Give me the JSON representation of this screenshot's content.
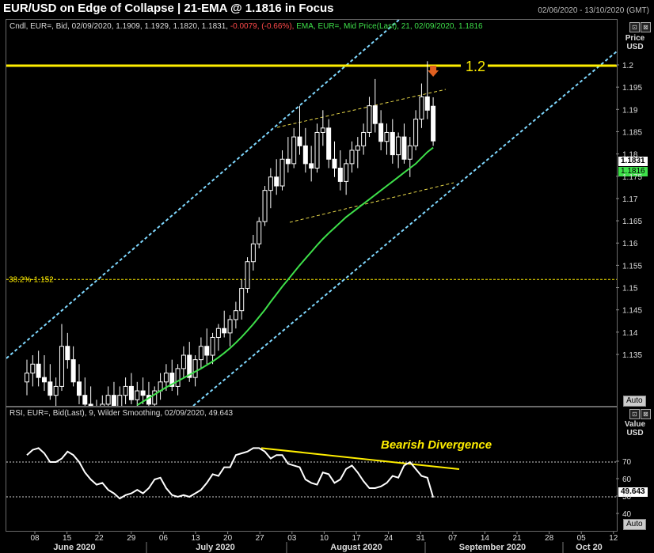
{
  "header": {
    "title": "EUR/USD on Edge of Collapse | 21-EMA @ 1.1816 in Focus",
    "date_range": "02/06/2020 - 13/10/2020 (GMT)"
  },
  "price_panel": {
    "legend_main": "Cndl, EUR=, Bid, 02/09/2020, 1.1909, 1.1929, 1.1820, 1.1831,",
    "legend_change": "-0.0079, (-0.66%),",
    "legend_ema": "EMA, EUR=, Mid Price(Last), 21, 02/09/2020, 1.1816",
    "axis_title_1": "Price",
    "axis_title_2": "USD",
    "last_price": "1.1831",
    "ema_value": "1.1816",
    "level_label": "1.2",
    "fib_label": "38.2%-1.152",
    "auto": "Auto",
    "btn_a": "⊡",
    "btn_b": "⊠"
  },
  "rsi_panel": {
    "legend": "RSI, EUR=, Bid(Last), 9, Wilder Smoothing, 02/09/2020, 49.643",
    "axis_title_1": "Value",
    "axis_title_2": "USD",
    "last_value": "49.643",
    "annotation": "Bearish Divergence",
    "auto": "Auto",
    "btn_a": "⊡",
    "btn_b": "⊠"
  },
  "colors": {
    "candle": "#ffffff",
    "ema": "#3ee04a",
    "level": "#ffee00",
    "channel": "#7fd8ff",
    "wedge": "#e8d84a",
    "arrow": "#e06020",
    "negative": "#ff4a4a"
  },
  "chart_data": [
    {
      "type": "candlestick",
      "title": "EUR/USD on Edge of Collapse | 21-EMA @ 1.1816 in Focus",
      "ylabel": "Price USD",
      "ylim": [
        1.13,
        1.21
      ],
      "y_ticks": [
        1.135,
        1.14,
        1.145,
        1.15,
        1.155,
        1.16,
        1.165,
        1.17,
        1.175,
        1.18,
        1.185,
        1.19,
        1.195,
        1.2
      ],
      "x_ticks": [
        "08",
        "15",
        "22",
        "29",
        "06",
        "13",
        "20",
        "27",
        "03",
        "10",
        "17",
        "24",
        "31",
        "07",
        "14",
        "21",
        "28",
        "05",
        "12"
      ],
      "x_months": [
        "June 2020",
        "July 2020",
        "August 2020",
        "September 2020",
        "Oct 20"
      ],
      "horizontal_levels": [
        {
          "value": 1.2,
          "label": "1.2"
        },
        {
          "value": 1.152,
          "label": "38.2%-1.152"
        }
      ],
      "ohlc": [
        [
          1.129,
          1.134,
          1.126,
          1.131
        ],
        [
          1.131,
          1.135,
          1.128,
          1.133
        ],
        [
          1.133,
          1.136,
          1.128,
          1.13
        ],
        [
          1.13,
          1.135,
          1.127,
          1.129
        ],
        [
          1.129,
          1.133,
          1.125,
          1.126
        ],
        [
          1.126,
          1.13,
          1.123,
          1.128
        ],
        [
          1.128,
          1.142,
          1.127,
          1.137
        ],
        [
          1.137,
          1.14,
          1.132,
          1.134
        ],
        [
          1.134,
          1.137,
          1.128,
          1.129
        ],
        [
          1.129,
          1.133,
          1.124,
          1.126
        ],
        [
          1.126,
          1.13,
          1.122,
          1.124
        ],
        [
          1.124,
          1.128,
          1.12,
          1.122
        ],
        [
          1.122,
          1.125,
          1.118,
          1.121
        ],
        [
          1.121,
          1.126,
          1.119,
          1.124
        ],
        [
          1.124,
          1.128,
          1.121,
          1.126
        ],
        [
          1.126,
          1.129,
          1.122,
          1.123
        ],
        [
          1.123,
          1.128,
          1.121,
          1.126
        ],
        [
          1.126,
          1.13,
          1.124,
          1.128
        ],
        [
          1.128,
          1.131,
          1.124,
          1.125
        ],
        [
          1.125,
          1.129,
          1.123,
          1.127
        ],
        [
          1.127,
          1.13,
          1.124,
          1.126
        ],
        [
          1.126,
          1.129,
          1.122,
          1.124
        ],
        [
          1.124,
          1.128,
          1.122,
          1.127
        ],
        [
          1.127,
          1.131,
          1.125,
          1.129
        ],
        [
          1.129,
          1.133,
          1.127,
          1.131
        ],
        [
          1.131,
          1.134,
          1.127,
          1.128
        ],
        [
          1.128,
          1.133,
          1.126,
          1.132
        ],
        [
          1.132,
          1.137,
          1.13,
          1.135
        ],
        [
          1.135,
          1.138,
          1.129,
          1.13
        ],
        [
          1.13,
          1.135,
          1.128,
          1.134
        ],
        [
          1.134,
          1.139,
          1.132,
          1.137
        ],
        [
          1.137,
          1.141,
          1.133,
          1.135
        ],
        [
          1.135,
          1.14,
          1.133,
          1.139
        ],
        [
          1.139,
          1.142,
          1.136,
          1.141
        ],
        [
          1.141,
          1.145,
          1.139,
          1.14
        ],
        [
          1.14,
          1.144,
          1.137,
          1.143
        ],
        [
          1.143,
          1.147,
          1.141,
          1.145
        ],
        [
          1.145,
          1.152,
          1.143,
          1.15
        ],
        [
          1.15,
          1.157,
          1.149,
          1.156
        ],
        [
          1.156,
          1.162,
          1.154,
          1.16
        ],
        [
          1.16,
          1.166,
          1.159,
          1.165
        ],
        [
          1.165,
          1.173,
          1.164,
          1.172
        ],
        [
          1.172,
          1.177,
          1.168,
          1.175
        ],
        [
          1.175,
          1.179,
          1.171,
          1.173
        ],
        [
          1.173,
          1.181,
          1.172,
          1.179
        ],
        [
          1.179,
          1.184,
          1.176,
          1.178
        ],
        [
          1.178,
          1.186,
          1.177,
          1.184
        ],
        [
          1.184,
          1.191,
          1.18,
          1.182
        ],
        [
          1.182,
          1.186,
          1.176,
          1.178
        ],
        [
          1.178,
          1.182,
          1.174,
          1.177
        ],
        [
          1.177,
          1.187,
          1.176,
          1.185
        ],
        [
          1.185,
          1.19,
          1.182,
          1.186
        ],
        [
          1.186,
          1.188,
          1.177,
          1.179
        ],
        [
          1.179,
          1.183,
          1.175,
          1.177
        ],
        [
          1.177,
          1.181,
          1.172,
          1.174
        ],
        [
          1.174,
          1.179,
          1.171,
          1.178
        ],
        [
          1.178,
          1.183,
          1.176,
          1.181
        ],
        [
          1.181,
          1.184,
          1.177,
          1.182
        ],
        [
          1.182,
          1.187,
          1.18,
          1.185
        ],
        [
          1.185,
          1.193,
          1.184,
          1.191
        ],
        [
          1.191,
          1.197,
          1.185,
          1.187
        ],
        [
          1.187,
          1.19,
          1.181,
          1.183
        ],
        [
          1.183,
          1.187,
          1.18,
          1.185
        ],
        [
          1.185,
          1.188,
          1.178,
          1.18
        ],
        [
          1.18,
          1.185,
          1.177,
          1.184
        ],
        [
          1.184,
          1.187,
          1.178,
          1.179
        ],
        [
          1.179,
          1.184,
          1.175,
          1.182
        ],
        [
          1.182,
          1.19,
          1.181,
          1.188
        ],
        [
          1.188,
          1.196,
          1.186,
          1.193
        ],
        [
          1.193,
          1.201,
          1.188,
          1.19
        ],
        [
          1.1909,
          1.1929,
          1.182,
          1.1831
        ]
      ],
      "ema_21": [
        1.1075,
        1.1085,
        1.1095,
        1.1105,
        1.1113,
        1.1121,
        1.113,
        1.114,
        1.115,
        1.1158,
        1.1166,
        1.1174,
        1.1182,
        1.119,
        1.1198,
        1.1206,
        1.1214,
        1.1222,
        1.123,
        1.1238,
        1.1246,
        1.1254,
        1.1262,
        1.127,
        1.1278,
        1.1285,
        1.1292,
        1.1299,
        1.1306,
        1.1313,
        1.132,
        1.1328,
        1.1336,
        1.1345,
        1.1355,
        1.1366,
        1.1378,
        1.1391,
        1.1405,
        1.142,
        1.1436,
        1.1452,
        1.147,
        1.1487,
        1.1504,
        1.152,
        1.1536,
        1.1552,
        1.1567,
        1.1582,
        1.1597,
        1.1611,
        1.1624,
        1.1636,
        1.1648,
        1.166,
        1.167,
        1.168,
        1.169,
        1.17,
        1.171,
        1.172,
        1.173,
        1.174,
        1.175,
        1.176,
        1.177,
        1.178,
        1.1793,
        1.1806,
        1.1816
      ]
    },
    {
      "type": "line",
      "title": "RSI, EUR=, Bid(Last), 9, Wilder Smoothing, 02/09/2020, 49.643",
      "ylabel": "Value USD",
      "ylim": [
        35,
        80
      ],
      "y_ticks": [
        40,
        50,
        60,
        70
      ],
      "reference_lines": [
        70,
        50
      ],
      "series": [
        {
          "values": [
            74,
            77,
            78,
            75,
            70,
            70,
            72,
            76,
            74,
            70,
            64,
            60,
            57,
            58,
            54,
            52,
            49,
            51,
            52,
            54,
            52,
            55,
            60,
            61,
            55,
            51,
            50,
            51,
            50,
            52,
            54,
            58,
            63,
            62,
            67,
            67,
            74,
            75,
            76,
            78,
            78,
            76,
            72,
            74,
            74,
            69,
            68,
            67,
            60,
            58,
            57,
            64,
            63,
            58,
            60,
            66,
            68,
            64,
            59,
            55,
            55,
            56,
            58,
            62,
            61,
            68,
            70,
            66,
            62,
            61,
            49.643
          ]
        }
      ]
    }
  ]
}
